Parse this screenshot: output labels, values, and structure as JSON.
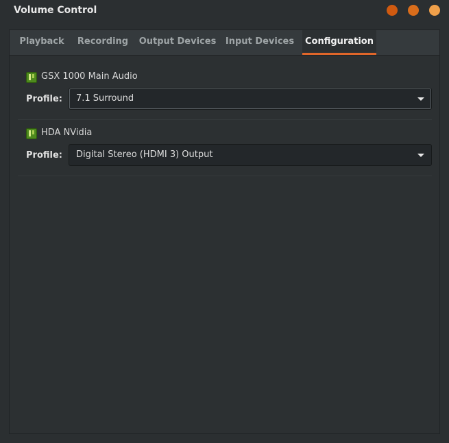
{
  "window": {
    "title": "Volume Control",
    "controls": [
      {
        "name": "minimize",
        "color": "#d05a10"
      },
      {
        "name": "maximize",
        "color": "#d96d1b"
      },
      {
        "name": "close",
        "color": "#f0a04a"
      }
    ]
  },
  "tabs": [
    {
      "label": "Playback",
      "active": false
    },
    {
      "label": "Recording",
      "active": false
    },
    {
      "label": "Output Devices",
      "active": false
    },
    {
      "label": "Input Devices",
      "active": false
    },
    {
      "label": "Configuration",
      "active": true
    }
  ],
  "accent_color": "#e0662a",
  "devices": [
    {
      "name": "GSX 1000 Main Audio",
      "icon": "sound-card-icon",
      "profile_label": "Profile:",
      "profile_value": "7.1 Surround"
    },
    {
      "name": "HDA NVidia",
      "icon": "sound-card-icon",
      "profile_label": "Profile:",
      "profile_value": "Digital Stereo (HDMI 3) Output"
    }
  ]
}
